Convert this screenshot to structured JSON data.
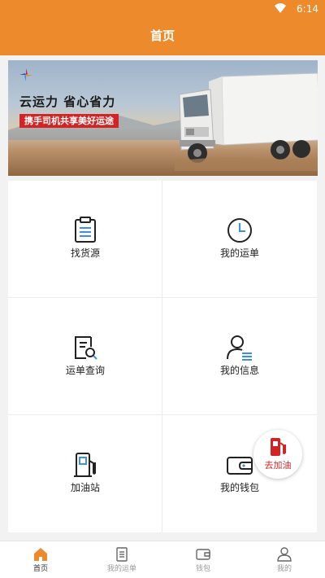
{
  "status_bar": {
    "time": "6:14"
  },
  "header": {
    "title": "首页"
  },
  "banner": {
    "headline": "云运力  省心省力",
    "slogan": "携手司机共享美好运途"
  },
  "menu": [
    {
      "label": "找货源",
      "icon": "document-list-icon"
    },
    {
      "label": "我的运单",
      "icon": "clock-icon"
    },
    {
      "label": "运单查询",
      "icon": "document-search-icon"
    },
    {
      "label": "我的信息",
      "icon": "user-info-icon"
    },
    {
      "label": "加油站",
      "icon": "fuel-pump-icon"
    },
    {
      "label": "我的钱包",
      "icon": "wallet-icon"
    }
  ],
  "fab": {
    "label": "去加油",
    "icon": "fuel-pump-icon"
  },
  "tabs": [
    {
      "label": "首页",
      "icon": "home-icon",
      "active": true
    },
    {
      "label": "我的运单",
      "icon": "document-icon",
      "active": false
    },
    {
      "label": "钱包",
      "icon": "wallet-icon",
      "active": false
    },
    {
      "label": "我的",
      "icon": "person-icon",
      "active": false
    }
  ],
  "colors": {
    "primary": "#ec8a2c",
    "accent_blue": "#3d8ee8",
    "alert_red": "#d22424"
  }
}
